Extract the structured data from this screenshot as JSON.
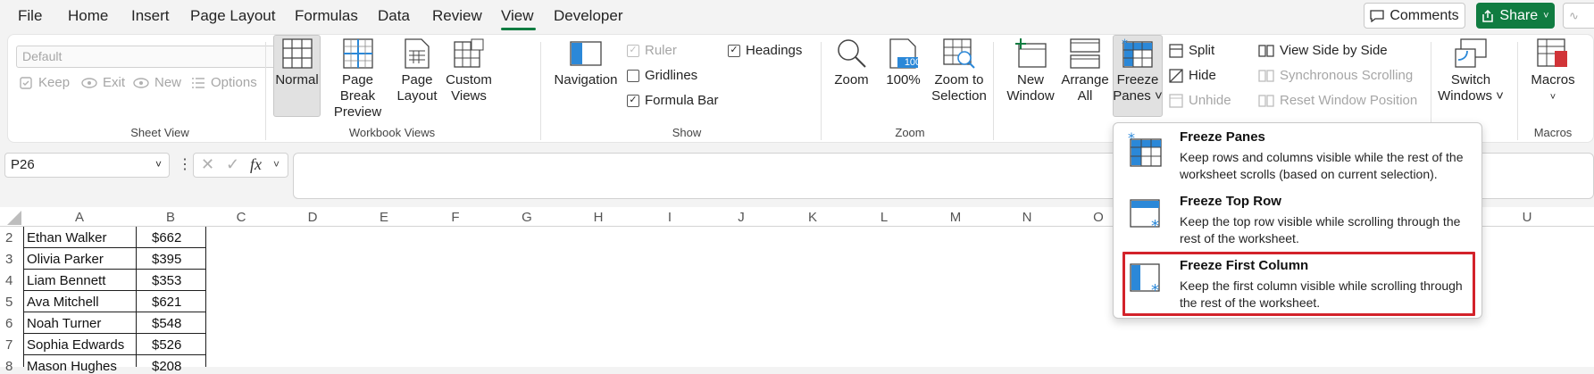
{
  "menu": {
    "file": "File",
    "home": "Home",
    "insert": "Insert",
    "page_layout": "Page Layout",
    "formulas": "Formulas",
    "data": "Data",
    "review": "Review",
    "view": "View",
    "developer": "Developer",
    "comments": "Comments",
    "share": "Share"
  },
  "sheet_view": {
    "select_value": "Default",
    "keep": "Keep",
    "exit": "Exit",
    "new": "New",
    "options": "Options",
    "group": "Sheet View"
  },
  "workbook_views": {
    "normal": "Normal",
    "page_break_1": "Page Break",
    "page_break_2": "Preview",
    "page_layout_1": "Page",
    "page_layout_2": "Layout",
    "custom_1": "Custom",
    "custom_2": "Views",
    "group": "Workbook Views"
  },
  "show": {
    "navigation": "Navigation",
    "ruler": "Ruler",
    "gridlines": "Gridlines",
    "formula_bar": "Formula Bar",
    "headings": "Headings",
    "group": "Show"
  },
  "zoom": {
    "zoom": "Zoom",
    "hundred": "100%",
    "hundred_icon": "100",
    "zoom_sel_1": "Zoom to",
    "zoom_sel_2": "Selection",
    "group": "Zoom"
  },
  "window": {
    "new_1": "New",
    "new_2": "Window",
    "arrange_1": "Arrange",
    "arrange_2": "All",
    "freeze_1": "Freeze",
    "freeze_2": "Panes ˅",
    "split": "Split",
    "hide": "Hide",
    "unhide": "Unhide",
    "side_by_side": "View Side by Side",
    "sync_scroll": "Synchronous Scrolling",
    "reset_pos": "Reset Window Position",
    "switch_1": "Switch",
    "switch_2": "Windows ˅"
  },
  "macros": {
    "label": "Macros",
    "group": "Macros"
  },
  "formula_bar": {
    "name_box": "P26",
    "fx": "fx"
  },
  "columns": [
    "A",
    "B",
    "C",
    "D",
    "E",
    "F",
    "G",
    "H",
    "I",
    "J",
    "K",
    "L",
    "M",
    "N",
    "O",
    "U"
  ],
  "rows": [
    {
      "num": "2",
      "name": "Ethan Walker",
      "value": "$662"
    },
    {
      "num": "3",
      "name": "Olivia Parker",
      "value": "$395"
    },
    {
      "num": "4",
      "name": "Liam Bennett",
      "value": "$353"
    },
    {
      "num": "5",
      "name": "Ava Mitchell",
      "value": "$621"
    },
    {
      "num": "6",
      "name": "Noah Turner",
      "value": "$548"
    },
    {
      "num": "7",
      "name": "Sophia Edwards",
      "value": "$526"
    },
    {
      "num": "8",
      "name": "Mason Hughes",
      "value": "$208"
    }
  ],
  "freeze_menu": {
    "items": [
      {
        "title": "Freeze Panes",
        "desc": "Keep rows and columns visible while the rest of the worksheet scrolls (based on current selection)."
      },
      {
        "title": "Freeze Top Row",
        "desc": "Keep the top row visible while scrolling through the rest of the worksheet."
      },
      {
        "title": "Freeze First Column",
        "desc": "Keep the first column visible while scrolling through the rest of the worksheet."
      }
    ]
  },
  "colors": {
    "accent": "#107c41",
    "highlight": "#d3222a",
    "icon_blue": "#2b88d8"
  }
}
